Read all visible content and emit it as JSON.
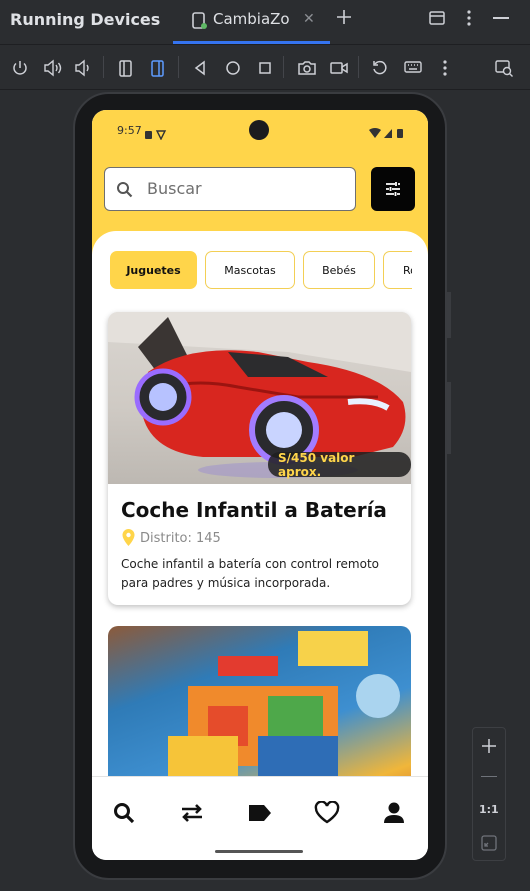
{
  "ide": {
    "panel_title": "Running Devices",
    "tab_label": "CambiaZo",
    "zoom": {
      "actual_size_label": "1:1"
    }
  },
  "phone": {
    "status_time": "9:57",
    "search": {
      "placeholder": "Buscar"
    },
    "categories": [
      "Juguetes",
      "Mascotas",
      "Bebés",
      "Ro"
    ],
    "active_category": "Juguetes",
    "products": [
      {
        "title": "Coche Infantil a Batería",
        "price": "S/450 valor aprox.",
        "location": "Distrito: 145",
        "description": "Coche infantil a batería con control remoto para padres y música incorporada."
      }
    ]
  },
  "colors": {
    "accent": "#ffd54a",
    "ide_bg": "#2b2d30",
    "tab_underline": "#3574f0"
  },
  "icons": [
    "power-icon",
    "volume-up-icon",
    "volume-down-icon",
    "rotate-left-icon",
    "rotate-right-icon",
    "back-icon",
    "home-icon",
    "overview-icon",
    "camera-icon",
    "record-icon",
    "reset-icon",
    "keyboard-icon",
    "more-icon",
    "device-mirror-icon",
    "search-icon",
    "swap-icon",
    "tag-icon",
    "heart-icon",
    "person-icon",
    "filter-icon",
    "location-pin-icon"
  ]
}
